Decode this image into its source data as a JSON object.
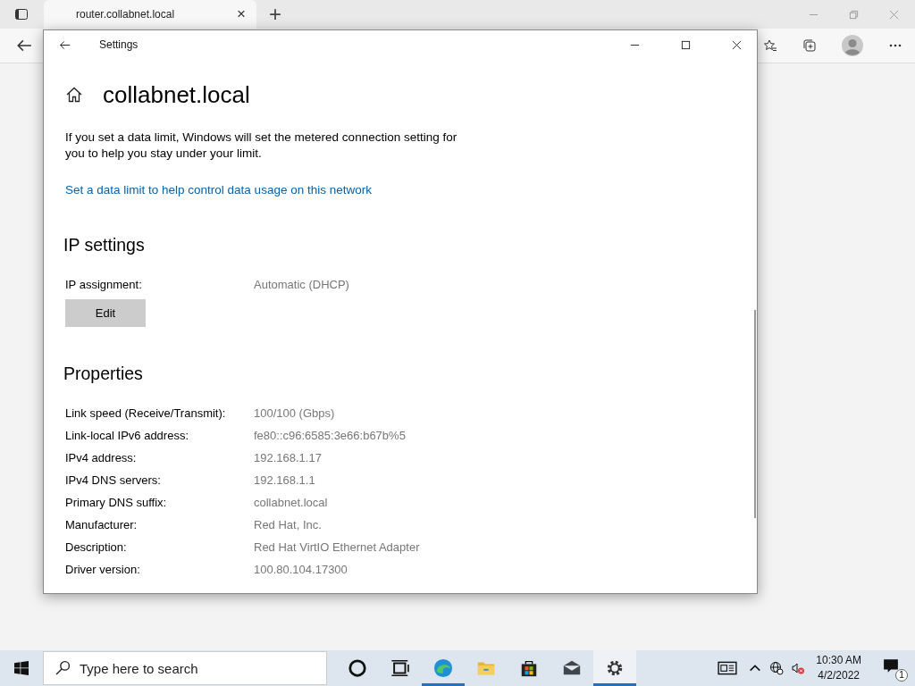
{
  "browser": {
    "tab": {
      "title": "router.collabnet.local",
      "close": "×",
      "selected": true
    },
    "new_tab": "+"
  },
  "settings": {
    "window_title": "Settings",
    "page_title": "collabnet.local",
    "info": "If you set a data limit, Windows will set the metered connection setting for you to help you stay under your limit.",
    "link": "Set a data limit to help control data usage on this network",
    "ip_section": "IP settings",
    "ip_assignment": {
      "label": "IP assignment:",
      "value": "Automatic (DHCP)"
    },
    "edit_button": "Edit",
    "properties_section": "Properties",
    "properties": [
      {
        "label": "Link speed (Receive/Transmit):",
        "value": "100/100 (Gbps)"
      },
      {
        "label": "Link-local IPv6 address:",
        "value": "fe80::c96:6585:3e66:b67b%5"
      },
      {
        "label": "IPv4 address:",
        "value": "192.168.1.17"
      },
      {
        "label": "IPv4 DNS servers:",
        "value": "192.168.1.1"
      },
      {
        "label": "Primary DNS suffix:",
        "value": "collabnet.local"
      },
      {
        "label": "Manufacturer:",
        "value": "Red Hat, Inc."
      },
      {
        "label": "Description:",
        "value": "Red Hat VirtIO Ethernet Adapter"
      },
      {
        "label": "Driver version:",
        "value": "100.80.104.17300"
      }
    ]
  },
  "taskbar": {
    "search_placeholder": "Type here to search",
    "time": "10:30 AM",
    "date": "4/2/2022",
    "notification_count": "1"
  }
}
